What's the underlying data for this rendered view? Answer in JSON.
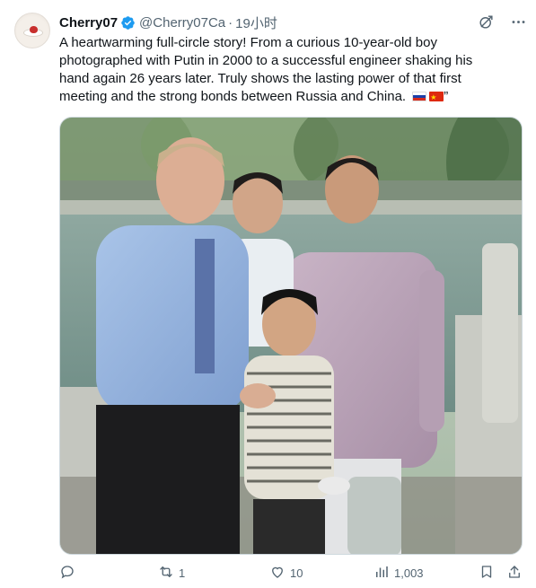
{
  "author": {
    "name": "Cherry07",
    "handle": "@Cherry07Ca",
    "separator": "·",
    "time": "19小时"
  },
  "header_icons": [
    "grok-icon",
    "more-icon"
  ],
  "text": {
    "line1": "A heartwarming full-circle story! From a curious 10-year-old boy",
    "line2": "photographed with Putin in 2000 to a successful engineer shaking his",
    "line3": "hand again 26 years later. Truly shows the lasting power of that first",
    "line4_main": "meeting and the strong bonds between Russia and China.",
    "line4_end": "”"
  },
  "flags": [
    "russia-flag",
    "china-flag"
  ],
  "actions": {
    "reply": {
      "icon": "reply-icon",
      "count": ""
    },
    "retweet": {
      "icon": "retweet-icon",
      "count": "1"
    },
    "like": {
      "icon": "like-icon",
      "count": "10"
    },
    "views": {
      "icon": "views-icon",
      "count": "1,003"
    },
    "bookmark": {
      "icon": "bookmark-icon"
    },
    "share": {
      "icon": "share-icon"
    }
  },
  "colors": {
    "text": "#0f1419",
    "secondary": "#536471",
    "verified": "#1d9bf0",
    "border": "#cfd9de"
  }
}
